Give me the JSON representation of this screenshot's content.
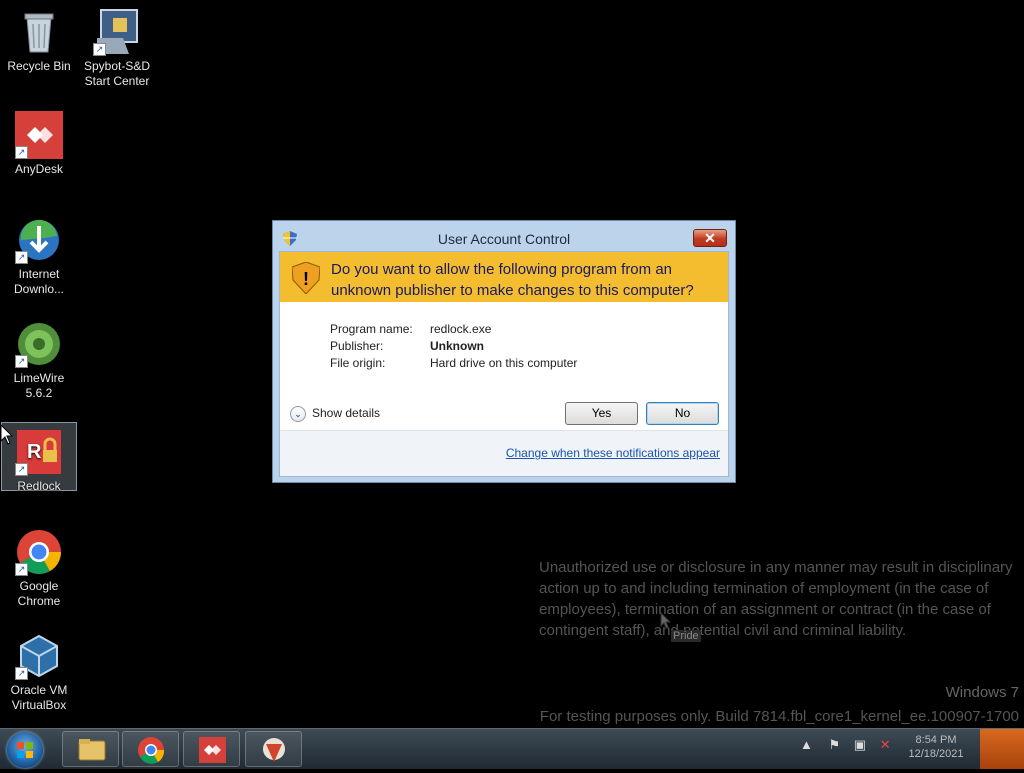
{
  "desktop": {
    "icons": [
      {
        "label": "Recycle Bin",
        "icon": "recycle-bin-icon"
      },
      {
        "label": "Spybot-S&D Start Center",
        "icon": "spybot-icon"
      },
      {
        "label": "AnyDesk",
        "icon": "anydesk-icon"
      },
      {
        "label": "Internet Downlo...",
        "icon": "internet-download-manager-icon"
      },
      {
        "label": "LimeWire 5.6.2",
        "icon": "limewire-icon"
      },
      {
        "label": "Redlock",
        "icon": "redlock-icon"
      },
      {
        "label": "Google Chrome",
        "icon": "chrome-icon"
      },
      {
        "label": "Oracle VM VirtualBox",
        "icon": "virtualbox-icon"
      }
    ],
    "notice": "Unauthorized use or disclosure in any manner may result in disciplinary action up to and including termination of employment (in the case of employees), termination of an assignment or contract (in the case of contingent staff), and potential civil and criminal liability.",
    "cursor_tooltip": "Pride",
    "windows_label": "Windows 7",
    "build_text": "For testing purposes only. Build 7814.fbl_core1_kernel_ee.100907-1700"
  },
  "dialog": {
    "title": "User Account Control",
    "close_label": "✕",
    "question": "Do you want to allow the following program from an unknown publisher to make changes to this computer?",
    "details": [
      {
        "key": "Program name:",
        "value": "redlock.exe"
      },
      {
        "key": "Publisher:",
        "value": "Unknown"
      },
      {
        "key": "File origin:",
        "value": "Hard drive on this computer"
      }
    ],
    "show_details_label": "Show details",
    "yes_label": "Yes",
    "no_label": "No",
    "change_link": "Change when these notifications appear",
    "banner_color": "#f4bd2f"
  },
  "taskbar": {
    "pinned": [
      "explorer-icon",
      "chrome-icon",
      "anydesk-icon",
      "app-icon"
    ],
    "clock_time": "8:54 PM",
    "clock_date": "12/18/2021"
  }
}
